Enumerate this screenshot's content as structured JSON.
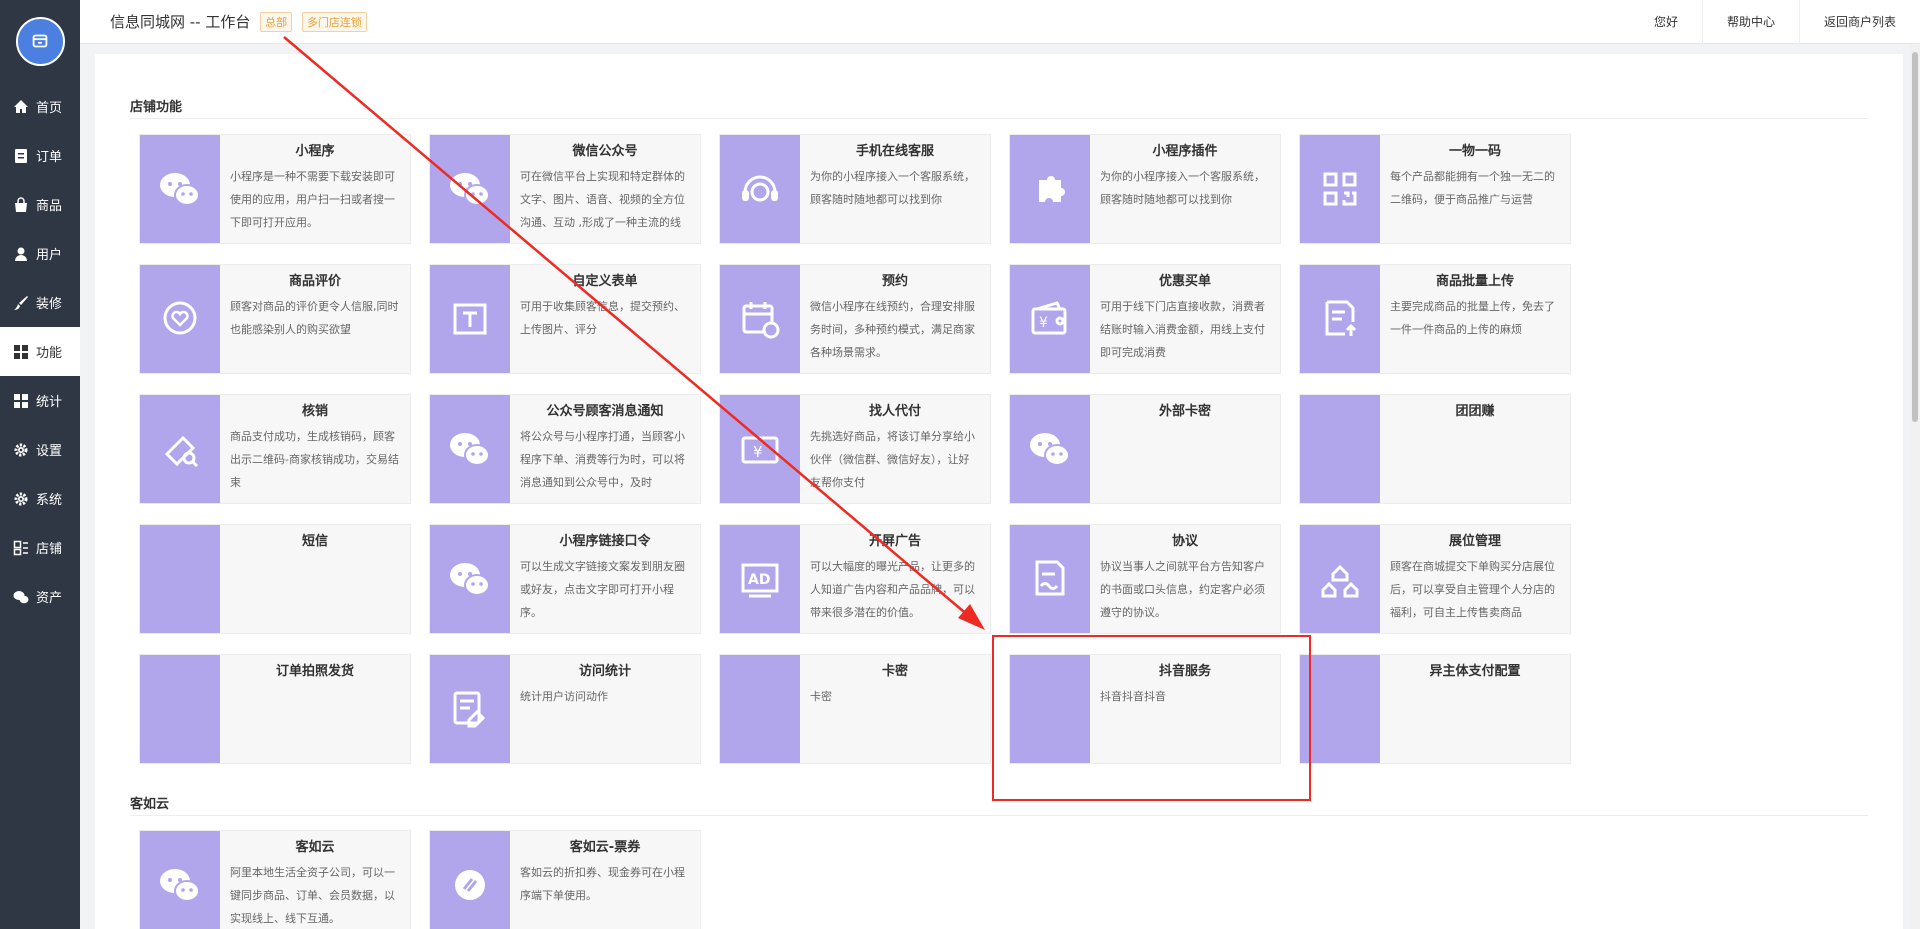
{
  "app": {
    "title": "信息同城网 -- 工作台",
    "tags": [
      "总部",
      "多门店连锁"
    ]
  },
  "header": {
    "links": [
      "您好",
      "帮助中心",
      "返回商户列表"
    ]
  },
  "sidebar": {
    "items": [
      {
        "label": "首页",
        "icon": "home-icon"
      },
      {
        "label": "订单",
        "icon": "order-icon"
      },
      {
        "label": "商品",
        "icon": "bag-icon"
      },
      {
        "label": "用户",
        "icon": "user-icon"
      },
      {
        "label": "装修",
        "icon": "brush-icon"
      },
      {
        "label": "功能",
        "icon": "grid-icon"
      },
      {
        "label": "统计",
        "icon": "grid-icon"
      },
      {
        "label": "设置",
        "icon": "gear-icon"
      },
      {
        "label": "系统",
        "icon": "gear-icon"
      },
      {
        "label": "店铺",
        "icon": "store-icon"
      },
      {
        "label": "资产",
        "icon": "wechat-icon"
      }
    ],
    "active_index": 5
  },
  "sections": [
    {
      "title": "店铺功能",
      "cards": [
        {
          "title": "小程序",
          "desc": "小程序是一种不需要下载安装即可使用的应用，用户扫一扫或者搜一下即可打开应用。",
          "icon": "wechat-icon"
        },
        {
          "title": "微信公众号",
          "desc": "可在微信平台上实现和特定群体的文字、图片、语音、视频的全方位沟通、互动 ,形成了一种主流的线上线下微信互动营销方式",
          "icon": "wechat-icon"
        },
        {
          "title": "手机在线客服",
          "desc": "为你的小程序接入一个客服系统，顾客随时随地都可以找到你",
          "icon": "headset-icon"
        },
        {
          "title": "小程序插件",
          "desc": "为你的小程序接入一个客服系统，顾客随时随地都可以找到你",
          "icon": "puzzle-icon"
        },
        {
          "title": "一物一码",
          "desc": "每个产品都能拥有一个独一无二的二维码，便于商品推广与运营",
          "icon": "qrcode-icon"
        },
        {
          "title": "商品评价",
          "desc": "顾客对商品的评价更令人信服,同时也能感染别人的购买欲望",
          "icon": "heart-chat-icon"
        },
        {
          "title": "自定义表单",
          "desc": "可用于收集顾客信息，提交预约、上传图片、评分",
          "icon": "text-box-icon"
        },
        {
          "title": "预约",
          "desc": "微信小程序在线预约，合理安排服务时间，多种预约模式，满足商家各种场景需求。",
          "icon": "calendar-icon"
        },
        {
          "title": "优惠买单",
          "desc": "可用于线下门店直接收款，消费者结账时输入消费金额，用线上支付即可完成消费",
          "icon": "wallet-icon"
        },
        {
          "title": "商品批量上传",
          "desc": "主要完成商品的批量上传，免去了一件一件商品的上传的麻烦",
          "icon": "upload-doc-icon"
        },
        {
          "title": "核销",
          "desc": "商品支付成功，生成核销码，顾客出示二维码-商家核销成功，交易结束",
          "icon": "ticket-check-icon"
        },
        {
          "title": "公众号顾客消息通知",
          "desc": "将公众号与小程序打通，当顾客小程序下单、消费等行为时，可以将消息通知到公众号中，及时",
          "icon": "wechat-icon"
        },
        {
          "title": "找人代付",
          "desc": "先挑选好商品，将该订单分享给小伙伴（微信群、微信好友），让好友帮你支付",
          "icon": "envelope-yuan-icon"
        },
        {
          "title": "外部卡密",
          "desc": "",
          "icon": "wechat-icon"
        },
        {
          "title": "团团赚",
          "desc": "",
          "icon": ""
        },
        {
          "title": "短信",
          "desc": "",
          "icon": ""
        },
        {
          "title": "小程序链接口令",
          "desc": "可以生成文字链接文案发到朋友圈或好友，点击文字即可打开小程序。",
          "icon": "wechat-icon"
        },
        {
          "title": "开屏广告",
          "desc": "可以大幅度的曝光产品，让更多的人知道广告内容和产品品牌，可以带来很多潜在的价值。",
          "icon": "ad-icon"
        },
        {
          "title": "协议",
          "desc": "协议当事人之间就平台方告知客户的书面或口头信息，约定客户必须遵守的协议。",
          "icon": "sign-doc-icon"
        },
        {
          "title": "展位管理",
          "desc": "顾客在商城提交下单购买分店展位后，可以享受自主管理个人分店的福利，可自主上传售卖商品",
          "icon": "houses-icon"
        },
        {
          "title": "订单拍照发货",
          "desc": "",
          "icon": ""
        },
        {
          "title": "访问统计",
          "desc": "统计用户访问动作",
          "icon": "edit-doc-icon"
        },
        {
          "title": "卡密",
          "desc": "卡密",
          "icon": ""
        },
        {
          "title": "抖音服务",
          "desc": "抖音抖音抖音",
          "icon": ""
        },
        {
          "title": "异主体支付配置",
          "desc": "",
          "icon": ""
        }
      ]
    },
    {
      "title": "客如云",
      "cards": [
        {
          "title": "客如云",
          "desc": "阿里本地生活全资子公司，可以一键同步商品、订单、会员数据，以实现线上、线下互通。",
          "icon": "wechat-icon"
        },
        {
          "title": "客如云-票券",
          "desc": "客如云的折扣券、现金券可在小程序端下单使用。",
          "icon": "coupon-icon"
        }
      ]
    }
  ],
  "colors": {
    "sidebar_bg": "#2f3744",
    "card_icon_bg": "#b1a6ec",
    "annotation": "#ee2a24",
    "tag_orange": "#e6a23c"
  }
}
